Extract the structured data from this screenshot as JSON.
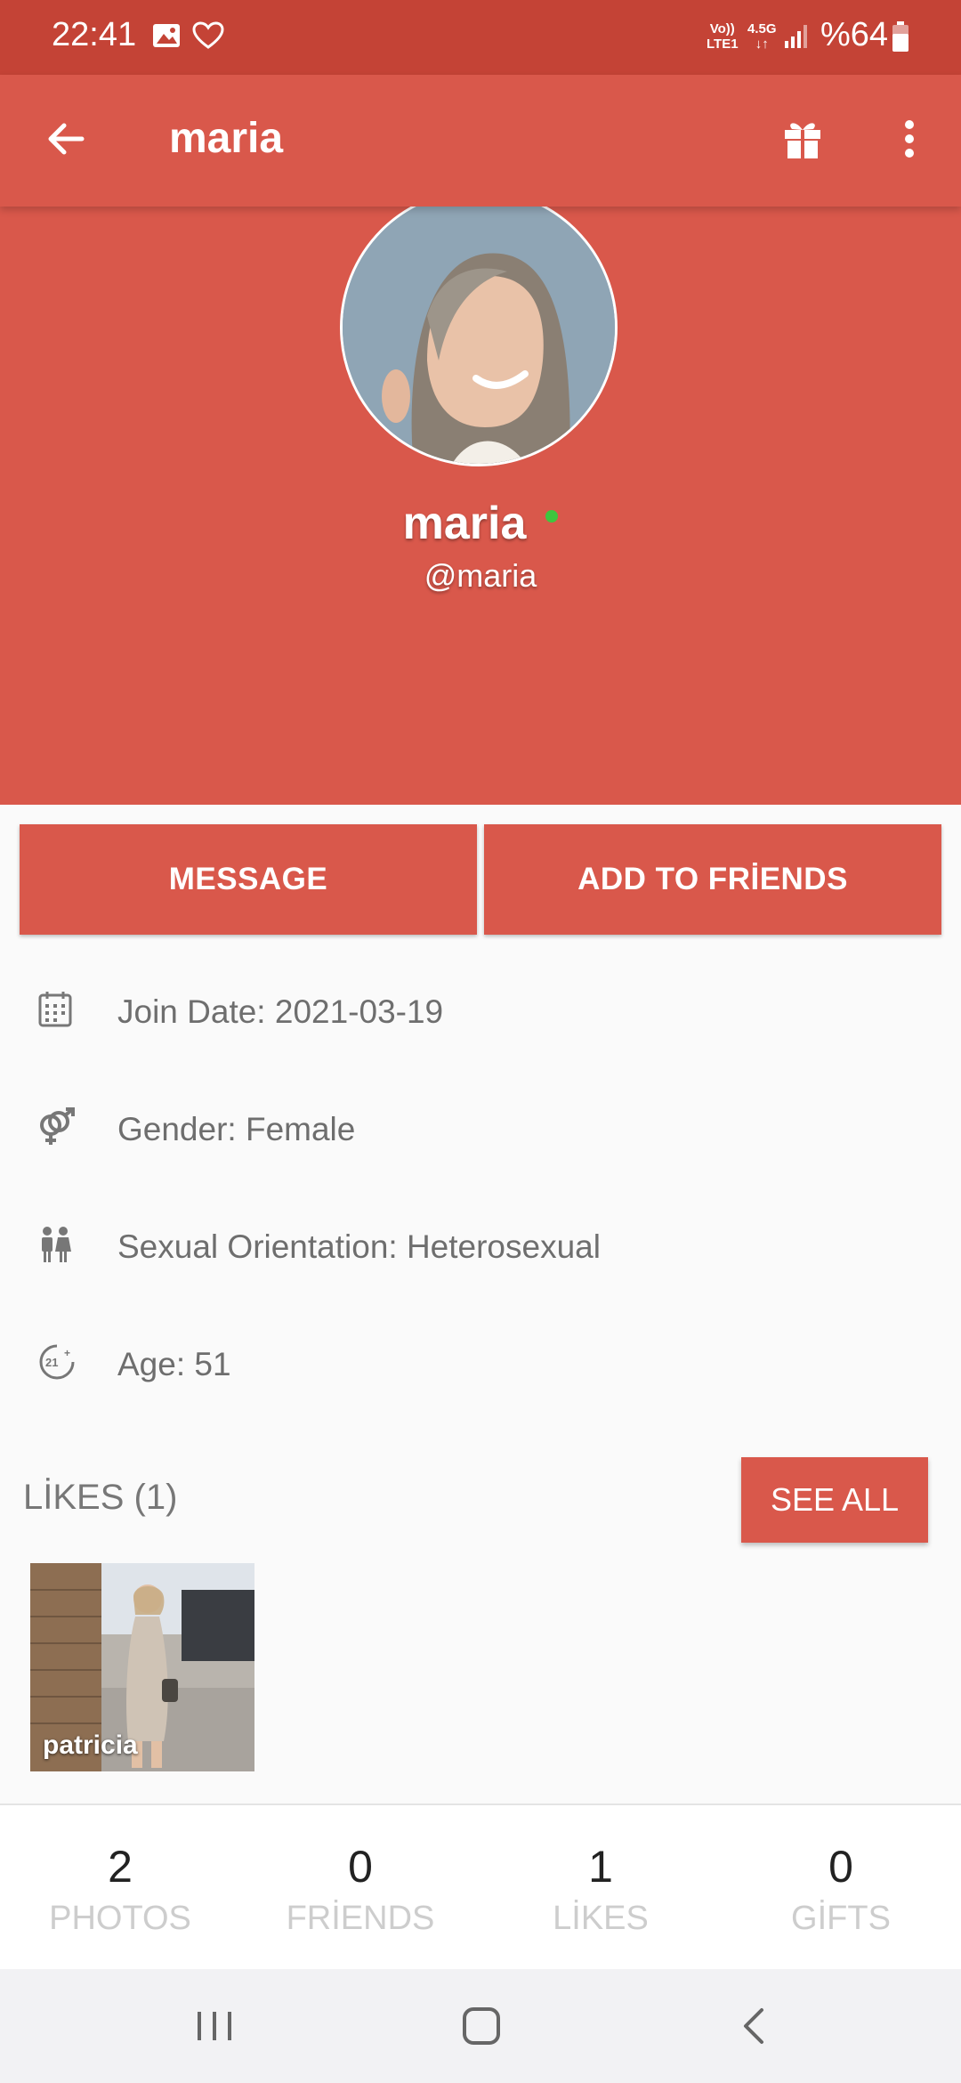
{
  "status_bar": {
    "time": "22:41",
    "network_top": "Vo))",
    "network_bottom": "LTE1",
    "network_type": "4.5G",
    "battery": "%64"
  },
  "app_bar": {
    "title": "maria"
  },
  "profile": {
    "name": "maria",
    "handle": "@maria",
    "online": true
  },
  "actions": {
    "message_label": "MESSAGE",
    "add_friends_label": "ADD TO FRİENDS"
  },
  "info": [
    {
      "icon": "calendar-icon",
      "text": "Join Date: 2021-03-19"
    },
    {
      "icon": "gender-icon",
      "text": "Gender: Female"
    },
    {
      "icon": "couple-icon",
      "text": "Sexual Orientation: Heterosexual"
    },
    {
      "icon": "age-21-icon",
      "text": "Age: 51"
    }
  ],
  "likes": {
    "title": "LİKES (1)",
    "see_all_label": "SEE ALL",
    "items": [
      {
        "name": "patricia"
      }
    ]
  },
  "stats": [
    {
      "value": "2",
      "label": "PHOTOS"
    },
    {
      "value": "0",
      "label": "FRİENDS"
    },
    {
      "value": "1",
      "label": "LİKES"
    },
    {
      "value": "0",
      "label": "GİFTS"
    }
  ],
  "colors": {
    "primary": "#d9584b",
    "status_bar": "#c44336",
    "online": "#3ec63e"
  }
}
